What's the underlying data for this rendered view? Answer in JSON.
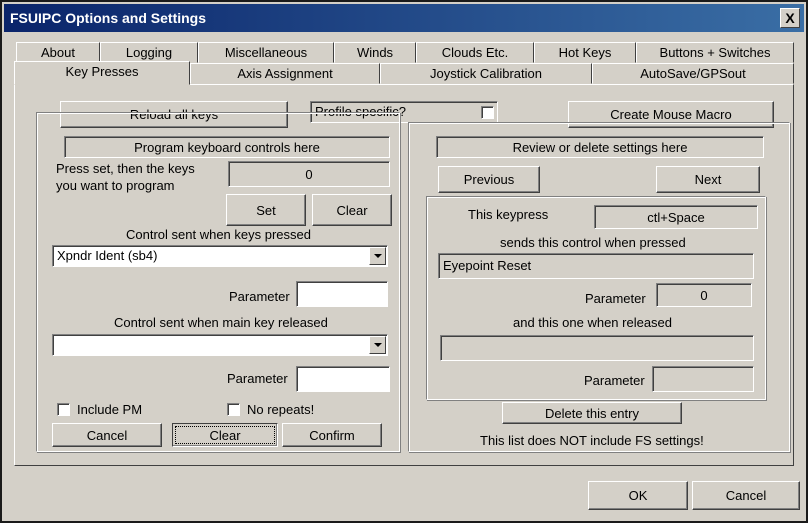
{
  "window": {
    "title": "FSUIPC Options and Settings",
    "close": "X"
  },
  "tabs": {
    "row1": [
      "About",
      "Logging",
      "Miscellaneous",
      "Winds",
      "Clouds Etc.",
      "Hot Keys",
      "Buttons + Switches"
    ],
    "row2": [
      "Key Presses",
      "Axis Assignment",
      "Joystick Calibration",
      "AutoSave/GPSout"
    ],
    "active": "Key Presses"
  },
  "top": {
    "reload": "Reload all keys",
    "profile_specific": "Profile specific?",
    "create_macro": "Create Mouse Macro"
  },
  "left": {
    "header": "Program keyboard controls here",
    "press_set": "Press set, then the keys",
    "you_want": "you want to program",
    "key_value": "0",
    "set": "Set",
    "clear": "Clear",
    "control_pressed_label": "Control sent when keys pressed",
    "control_pressed_value": "Xpndr Ident (sb4)",
    "parameter1": "Parameter",
    "parameter1_value": "",
    "control_released_label": "Control sent when main key released",
    "control_released_value": "",
    "parameter2": "Parameter",
    "parameter2_value": "",
    "include_pm": "Include PM",
    "no_repeats": "No repeats!",
    "cancel": "Cancel",
    "clear2": "Clear",
    "confirm": "Confirm"
  },
  "right": {
    "header": "Review or delete settings here",
    "previous": "Previous",
    "next": "Next",
    "this_keypress": "This keypress",
    "keypress_value": "ctl+Space",
    "sends_label": "sends this control when pressed",
    "control_value": "Eyepoint Reset",
    "parameter1": "Parameter",
    "parameter1_value": "0",
    "released_label": "and this one when released",
    "released_value": "",
    "parameter2": "Parameter",
    "parameter2_value": "",
    "delete": "Delete this entry",
    "note": "This list does NOT include FS settings!"
  },
  "footer": {
    "ok": "OK",
    "cancel": "Cancel"
  }
}
